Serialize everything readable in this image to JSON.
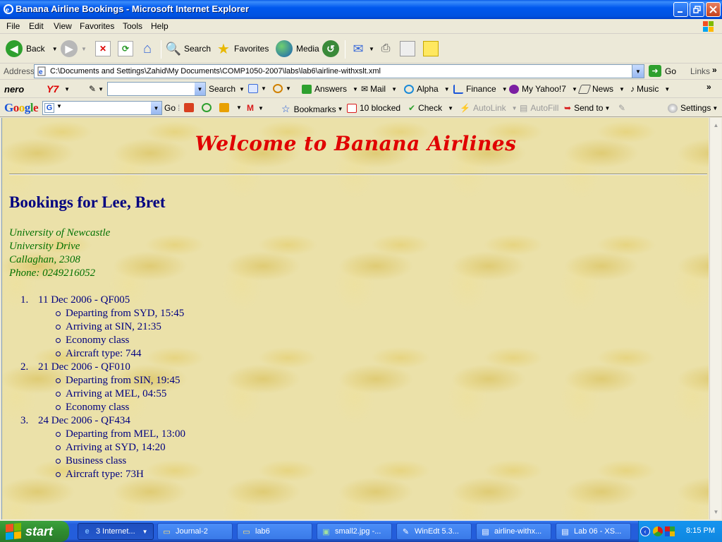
{
  "window": {
    "title": "Banana Airline Bookings - Microsoft Internet Explorer"
  },
  "menu": [
    "File",
    "Edit",
    "View",
    "Favorites",
    "Tools",
    "Help"
  ],
  "toolbar": {
    "back": "Back",
    "search": "Search",
    "favorites": "Favorites",
    "media": "Media"
  },
  "address": {
    "label": "Address",
    "url": "C:\\Documents and Settings\\Zahid\\My Documents\\COMP1050-2007\\labs\\lab6\\airline-withxslt.xml",
    "go": "Go",
    "links": "Links"
  },
  "yahoo": {
    "nero": "nero",
    "y7": "Y7",
    "search": "Search",
    "answers": "Answers",
    "mail": "Mail",
    "alpha": "Alpha",
    "finance": "Finance",
    "myyahoo": "My Yahoo!7",
    "news": "News",
    "music": "Music"
  },
  "google": {
    "logo": "Google",
    "go": "Go",
    "bookmarks": "Bookmarks",
    "blocked": "10 blocked",
    "check": "Check",
    "autolink": "AutoLink",
    "autofill": "AutoFill",
    "sendto": "Send to",
    "settings": "Settings"
  },
  "page": {
    "welcome": "Welcome to Banana Airlines",
    "bookings_title": "Bookings for Lee, Bret",
    "address_lines": [
      "University of Newcastle",
      "University Drive",
      "Callaghan, 2308",
      "Phone: 0249216052"
    ],
    "flights": [
      {
        "number": "1.",
        "header": "11 Dec 2006 - QF005",
        "details": [
          "Departing from SYD, 15:45",
          "Arriving at SIN, 21:35",
          "Economy class",
          "Aircraft type: 744"
        ]
      },
      {
        "number": "2.",
        "header": "21 Dec 2006 - QF010",
        "details": [
          "Departing from SIN, 19:45",
          "Arriving at MEL, 04:55",
          "Economy class"
        ]
      },
      {
        "number": "3.",
        "header": "24 Dec 2006 - QF434",
        "details": [
          "Departing from MEL, 13:00",
          "Arriving at SYD, 14:20",
          "Business class",
          "Aircraft type: 73H"
        ]
      }
    ]
  },
  "taskbar": {
    "start": "start",
    "tasks": [
      "3 Internet...",
      "Journal-2",
      "lab6",
      "small2.jpg -...",
      "WinEdt 5.3...",
      "airline-withx...",
      "Lab 06 - XS..."
    ],
    "clock": "8:15 PM"
  },
  "colors": {
    "welcome": "#e00000",
    "heading": "#000080",
    "address": "#007000",
    "background": "#ebe1a9"
  }
}
